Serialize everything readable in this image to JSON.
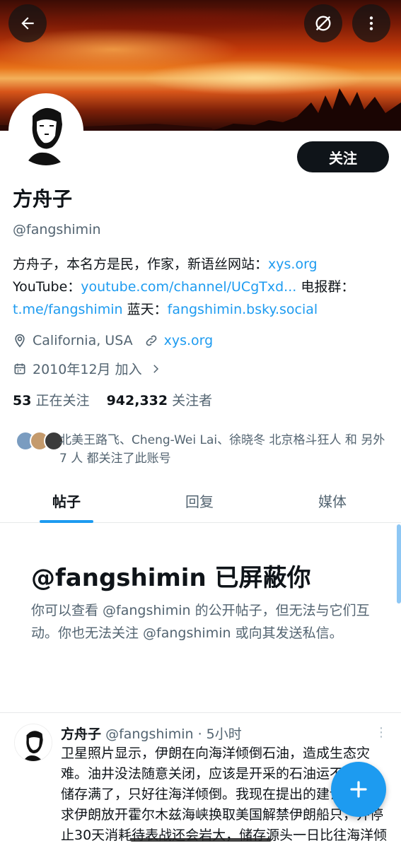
{
  "colors": {
    "accent": "#1d9bf0",
    "text": "#0f1419",
    "secondary": "#536471"
  },
  "header": {
    "back_icon": "arrow-left-icon",
    "grok_icon": "slash-circle-icon",
    "more_icon": "more-vertical-icon"
  },
  "profile": {
    "follow_label": "关注",
    "name": "方舟子",
    "handle": "@fangshimin",
    "bio": {
      "line1_text": "方舟子，本名方是民，作家，新语丝网站：",
      "line1_link": "xys.org",
      "line2_text": "YouTube：",
      "line2_link": "youtube.com/channel/UCgTxd...",
      "line2_tail": " 电报群：",
      "line3_link": "t.me/fangshimin",
      "line3_text": " 蓝天：",
      "line3_link2": "fangshimin.bsky.social"
    },
    "location": "California, USA",
    "website": "xys.org",
    "joined": "2010年12月 加入",
    "following_count": "53",
    "following_label": "正在关注",
    "followers_count": "942,332",
    "followers_label": "关注者",
    "followed_by": "北美王路飞、Cheng-Wei Lai、徐晓冬 北京格斗狂人 和 另外 7 人 都关注了此账号"
  },
  "tabs": [
    {
      "label": "帖子",
      "active": true
    },
    {
      "label": "回复",
      "active": false
    },
    {
      "label": "媒体",
      "active": false
    }
  ],
  "blocked": {
    "title": "@fangshimin 已屏蔽你",
    "text": "你可以查看 @fangshimin 的公开帖子，但无法与它们互动。你也无法关注 @fangshimin 或向其发送私信。"
  },
  "post": {
    "author": "方舟子",
    "handle": "@fangshimin",
    "time": " · 5小时",
    "body": "卫星照片显示，伊朗在向海洋倾倒石油，造成生态灾难。油井没法随意关闭，应该是开采的石油运不出去，储存满了，只好往海洋倾倒。我现在提出的建议只是要求伊朗放开霍尔木兹海峡换取美国解禁伊朗船只，并停止30天消耗待表战还会岩大，储存源头一日比往海洋倾倒"
  },
  "fab_icon": "plus-icon"
}
